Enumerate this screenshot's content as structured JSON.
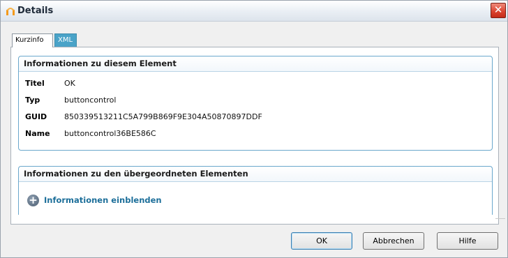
{
  "window": {
    "title": "Details",
    "close_symbol": "✕",
    "app_icon": "app-logo-icon",
    "colors": {
      "accent": "#4aa3c8",
      "group_border": "#6aa7cc",
      "link": "#1d6f9a",
      "close": "#d9412d"
    }
  },
  "tabs": [
    {
      "label": "Kurzinfo",
      "selected": true
    },
    {
      "label": "XML",
      "selected": false
    }
  ],
  "element_info": {
    "header": "Informationen zu diesem Element",
    "rows": [
      {
        "label": "Titel",
        "value": "OK"
      },
      {
        "label": "Typ",
        "value": "buttoncontrol"
      },
      {
        "label": "GUID",
        "value": "850339513211C5A799B869F9E304A50870897DDF"
      },
      {
        "label": "Name",
        "value": "buttoncontrol36BE586C"
      }
    ]
  },
  "parent_info": {
    "header": "Informationen zu den übergeordneten Elementen",
    "expand_label": "Informationen einblenden",
    "expand_icon": "plus-circle-icon"
  },
  "buttons": {
    "ok": "OK",
    "cancel": "Abbrechen",
    "help": "Hilfe"
  }
}
